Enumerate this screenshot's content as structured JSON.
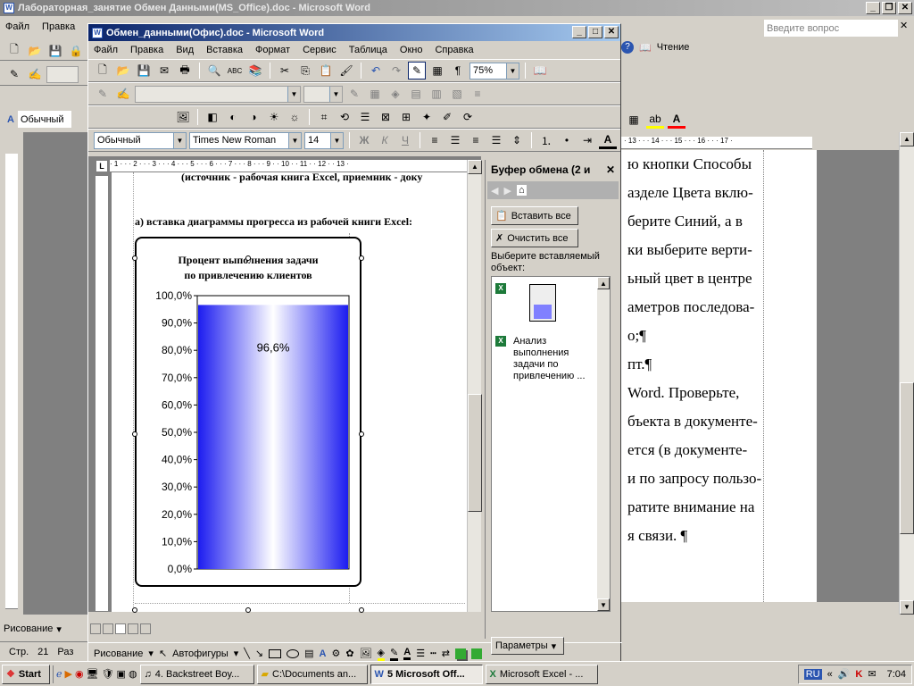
{
  "back_window": {
    "title": "Лабораторная_занятие Обмен Данными(MS_Office).doc - Microsoft Word",
    "menu": [
      "Файл",
      "Правка"
    ],
    "help_placeholder": "Введите вопрос",
    "reading_label": "Чтение",
    "style_label": "Обычный",
    "status_page": "Стр.",
    "status_page_num": "21",
    "status_section": "Раз",
    "drawing_label": "Рисование",
    "text_lines": [
      "ю кнопки Способы",
      "азделе Цвета вклю-",
      "берите Синий, а в",
      "ки выберите верти-",
      "ьный цвет в центре",
      "аметров последова-",
      "о;¶",
      "пт.¶",
      "",
      "Word. Проверьте,",
      "бъекта в документе-",
      "ется (в документе-",
      "и по запросу пользо-",
      "ратите внимание на",
      "я связи. ¶"
    ]
  },
  "front_window": {
    "title": "Обмен_данными(Офис).doc - Microsoft Word",
    "menu": [
      "Файл",
      "Правка",
      "Вид",
      "Вставка",
      "Формат",
      "Сервис",
      "Таблица",
      "Окно",
      "Справка"
    ],
    "zoom": "75%",
    "style": "Обычный",
    "font": "Times New Roman",
    "font_size": "14",
    "doc_line1": "(источник - рабочая книга Excel, приемник - доку",
    "doc_line2": "а) вставка диаграммы прогресса из рабочей книги Excel:",
    "drawing_label": "Рисование",
    "autoshapes_label": "Автофигуры"
  },
  "clipboard_pane": {
    "title": "Буфер обмена (2 и",
    "paste_all": "Вставить все",
    "clear_all": "Очистить все",
    "choose_label": "Выберите вставляемый объект:",
    "item2_text": "Анализ выполнения задачи по привлечению ...",
    "params_label": "Параметры"
  },
  "chart_data": {
    "type": "bar",
    "title": "Процент выполнения задачи по привлечению клиентов",
    "title_line1": "Процент выполнения задачи",
    "title_line2": "по привлечению клиентов",
    "categories": [
      ""
    ],
    "values": [
      96.6
    ],
    "value_label": "96,6%",
    "ylim": [
      0,
      100
    ],
    "yticks": [
      "0,0%",
      "10,0%",
      "20,0%",
      "30,0%",
      "40,0%",
      "50,0%",
      "60,0%",
      "70,0%",
      "80,0%",
      "90,0%",
      "100,0%"
    ],
    "grid": false,
    "colors": {
      "edge": "#1c1cf0",
      "center": "#ffffff"
    }
  },
  "taskbar": {
    "start_label": "Start",
    "tasks": [
      "4. Backstreet Boy...",
      "C:\\Documents an...",
      "5 Microsoft Off...",
      "Microsoft Excel - ..."
    ],
    "lang": "RU",
    "time": "7:04"
  }
}
